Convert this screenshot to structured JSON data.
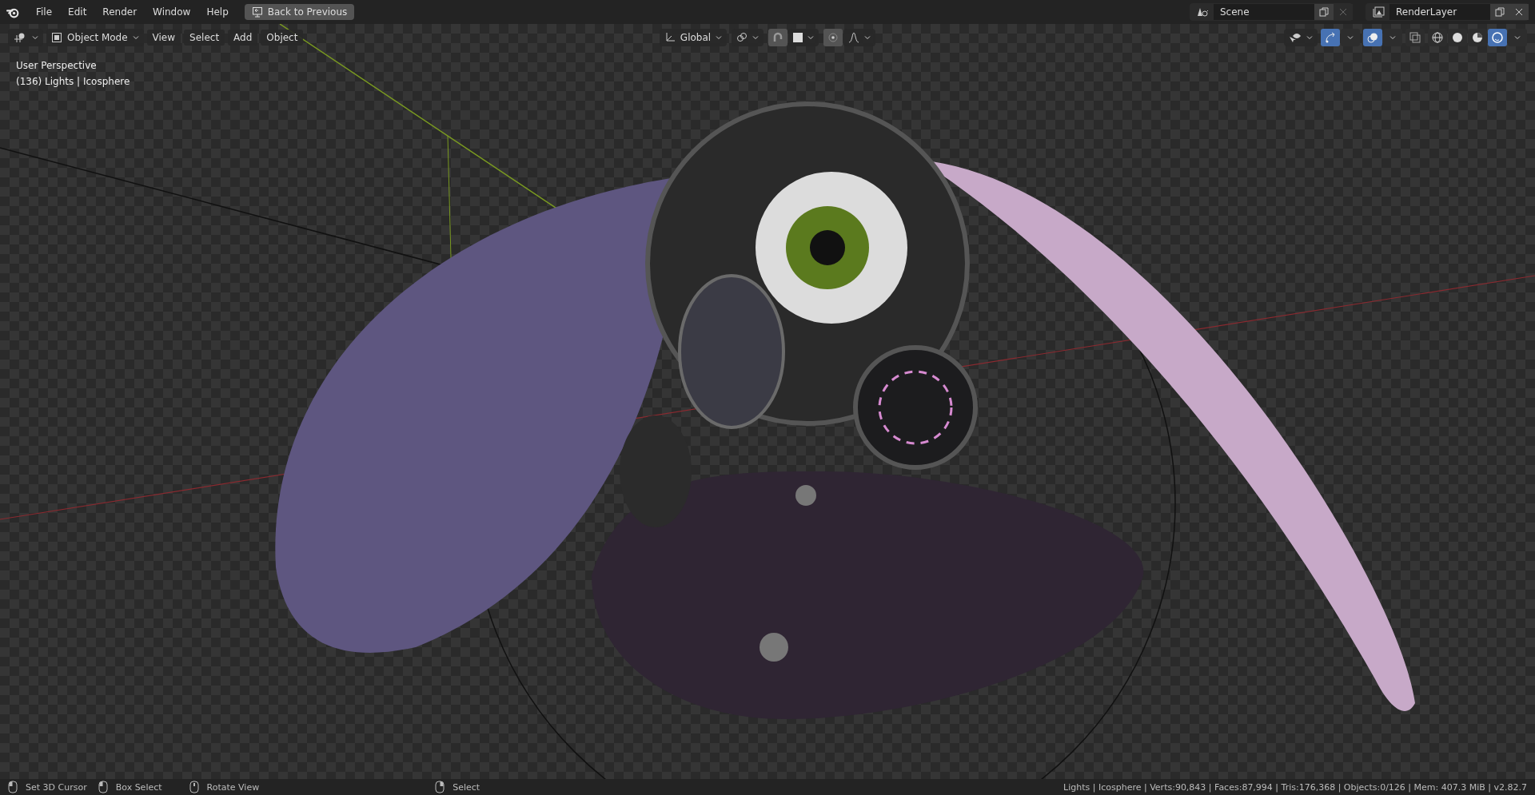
{
  "topbar": {
    "menus": [
      "File",
      "Edit",
      "Render",
      "Window",
      "Help"
    ],
    "back_button": "Back to Previous",
    "scene": "Scene",
    "view_layer": "RenderLayer"
  },
  "viewport": {
    "header": {
      "mode": "Object Mode",
      "menus": [
        "View",
        "Select",
        "Add",
        "Object"
      ],
      "orientation": "Global",
      "gizmos_on": true,
      "overlays_on": true,
      "xray_on": false,
      "shading_modes": [
        {
          "kind": "wireframe",
          "selected": false
        },
        {
          "kind": "solid",
          "selected": false
        },
        {
          "kind": "material",
          "selected": false
        },
        {
          "kind": "rendered",
          "selected": true
        }
      ]
    },
    "overlay_text": [
      "User Perspective",
      "(136) Lights | Icosphere"
    ]
  },
  "status_bar": {
    "hints": [
      {
        "kind": "left",
        "label": "Set 3D Cursor"
      },
      {
        "kind": "drag",
        "label": "Box Select"
      },
      {
        "kind": "middle",
        "label": "Rotate View"
      },
      {
        "kind": "right",
        "label": "Select"
      }
    ],
    "stats": "Lights | Icosphere | Verts:90,843 | Faces:87,994 | Tris:176,368 | Objects:0/126 | Mem: 407.3 MiB | v2.82.7"
  }
}
